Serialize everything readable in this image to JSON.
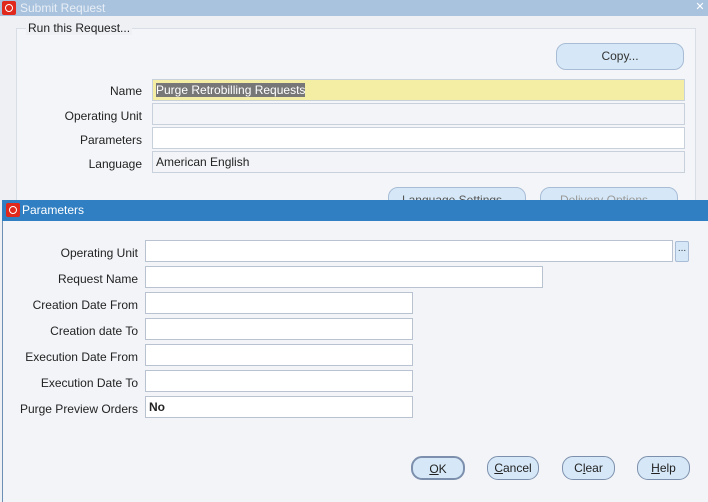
{
  "submit_window": {
    "title": "Submit Request",
    "group_label": "Run this Request...",
    "copy_label": "Copy...",
    "fields": {
      "name_label": "Name",
      "name_value": "Purge Retrobilling Requests",
      "ou_label": "Operating Unit",
      "ou_value": "",
      "params_label": "Parameters",
      "params_value": "",
      "lang_label": "Language",
      "lang_value": "American English"
    },
    "language_settings_label": "Language Settings...",
    "delivery_options_label": "Delivery Options..."
  },
  "parameters_window": {
    "title": "Parameters",
    "fields": [
      {
        "label": "Operating Unit",
        "value": ""
      },
      {
        "label": "Request Name",
        "value": ""
      },
      {
        "label": "Creation Date From",
        "value": ""
      },
      {
        "label": "Creation date To",
        "value": ""
      },
      {
        "label": "Execution Date From",
        "value": ""
      },
      {
        "label": "Execution Date To",
        "value": ""
      },
      {
        "label": "Purge Preview Orders",
        "value": "No"
      }
    ],
    "lov_label": "...",
    "buttons": {
      "ok_key": "O",
      "ok_rest": "K",
      "cancel_key": "C",
      "cancel_rest": "ancel",
      "clear_pre": "C",
      "clear_key": "l",
      "clear_rest": "ear",
      "help_key": "H",
      "help_rest": "elp"
    }
  }
}
